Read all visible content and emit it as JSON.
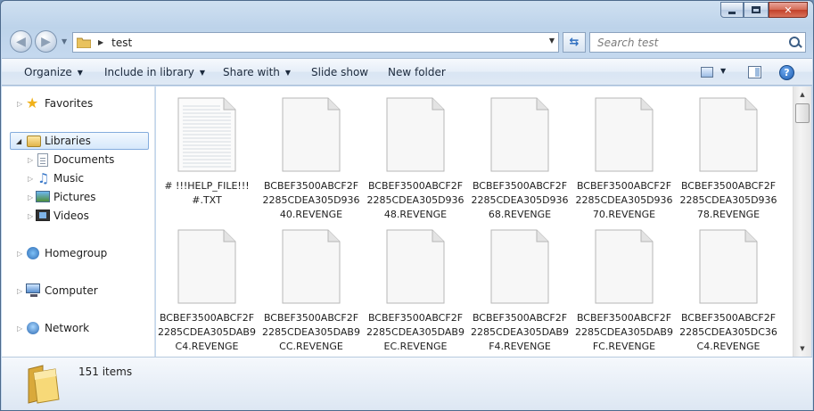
{
  "window": {
    "caption_buttons": [
      "minimize",
      "maximize",
      "close"
    ]
  },
  "address": {
    "path": "test",
    "search_placeholder": "Search test"
  },
  "toolbar": {
    "organize": "Organize",
    "include_in_library": "Include in library",
    "share_with": "Share with",
    "slide_show": "Slide show",
    "new_folder": "New folder"
  },
  "nav": {
    "favorites": "Favorites",
    "libraries": "Libraries",
    "documents": "Documents",
    "music": "Music",
    "pictures": "Pictures",
    "videos": "Videos",
    "homegroup": "Homegroup",
    "computer": "Computer",
    "network": "Network"
  },
  "files": [
    {
      "name": "# !!!HELP_FILE!!!\n#.TXT",
      "type": "text"
    },
    {
      "name": "BCBEF3500ABCF2F2285CDEA305D93640.REVENGE",
      "type": "blank"
    },
    {
      "name": "BCBEF3500ABCF2F2285CDEA305D93648.REVENGE",
      "type": "blank"
    },
    {
      "name": "BCBEF3500ABCF2F2285CDEA305D93668.REVENGE",
      "type": "blank"
    },
    {
      "name": "BCBEF3500ABCF2F2285CDEA305D93670.REVENGE",
      "type": "blank"
    },
    {
      "name": "BCBEF3500ABCF2F2285CDEA305D93678.REVENGE",
      "type": "blank"
    },
    {
      "name": "BCBEF3500ABCF2F2285CDEA305DAB9C4.REVENGE",
      "type": "blank"
    },
    {
      "name": "BCBEF3500ABCF2F2285CDEA305DAB9CC.REVENGE",
      "type": "blank"
    },
    {
      "name": "BCBEF3500ABCF2F2285CDEA305DAB9EC.REVENGE",
      "type": "blank"
    },
    {
      "name": "BCBEF3500ABCF2F2285CDEA305DAB9F4.REVENGE",
      "type": "blank"
    },
    {
      "name": "BCBEF3500ABCF2F2285CDEA305DAB9FC.REVENGE",
      "type": "blank"
    },
    {
      "name": "BCBEF3500ABCF2F2285CDEA305DC36C4.REVENGE",
      "type": "blank"
    }
  ],
  "status": {
    "item_count": "151 items"
  }
}
